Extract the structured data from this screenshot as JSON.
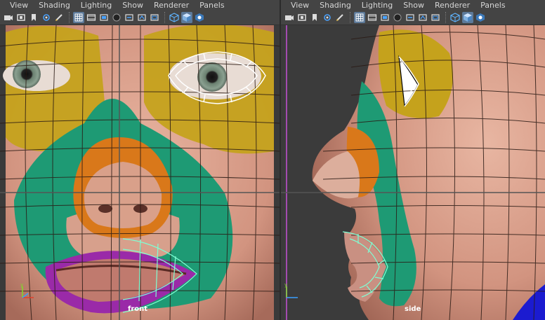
{
  "menu": [
    "View",
    "Shading",
    "Lighting",
    "Show",
    "Renderer",
    "Panels"
  ],
  "toolbar_icons": [
    "camera-icon",
    "film-icon",
    "bookmark-icon",
    "pivot-icon",
    "pen-icon",
    "grid-icon",
    "film-gate-icon",
    "resolution-gate-icon",
    "gate-mask-icon",
    "field-chart-icon",
    "safe-action-icon",
    "safe-title-icon",
    "wireframe-cube-icon",
    "smooth-shaded-cube-icon",
    "textured-icon"
  ],
  "viewports": {
    "front": {
      "camera_label": "front"
    },
    "side": {
      "camera_label": "side"
    }
  },
  "axis": {
    "x": "x",
    "y": "y",
    "z": "z"
  },
  "colors": {
    "ui_bg": "#444444",
    "skin": "#d9a08a",
    "skin_shadow": "#b57a68",
    "yellow_region": "#c8a818",
    "green_region": "#1e9a74",
    "orange_region": "#d9781a",
    "purple_region": "#9a2aa8",
    "selection_cyan": "#7fffd4",
    "viewport_bg": "#3c3c3c",
    "side_purple_line": "#a24bb0"
  }
}
